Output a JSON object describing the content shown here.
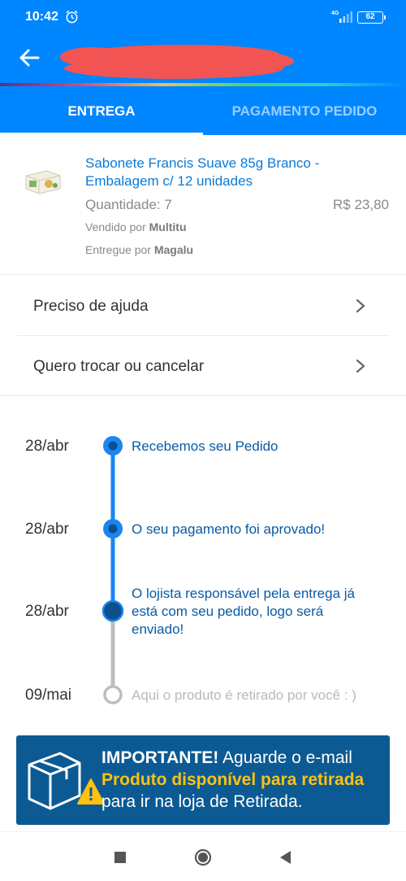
{
  "status_bar": {
    "time": "10:42",
    "network": "4G",
    "battery": "62"
  },
  "header": {
    "back_icon": "arrow-left-icon",
    "title": ""
  },
  "tabs": [
    {
      "label": "ENTREGA",
      "active": true
    },
    {
      "label": "PAGAMENTO PEDIDO",
      "active": false
    }
  ],
  "product": {
    "title": "Sabonete Francis Suave 85g Branco - Embalagem c/ 12 unidades",
    "quantity": "Quantidade: 7",
    "price": "R$ 23,80",
    "seller_prefix": "Vendido por",
    "seller_name": "Multitu",
    "delivery_prefix": "Entregue por",
    "delivery_name": "Magalu"
  },
  "menu": [
    {
      "label": "Preciso de ajuda",
      "icon": "chevron-right-icon"
    },
    {
      "label": "Quero trocar ou cancelar",
      "icon": "chevron-right-icon"
    }
  ],
  "timeline": [
    {
      "date": "28/abr",
      "text": "Recebemos seu Pedido",
      "status": "done"
    },
    {
      "date": "28/abr",
      "text": "O seu pagamento foi aprovado!",
      "status": "done"
    },
    {
      "date": "28/abr",
      "text": "O lojista responsável pela entrega já está com seu pedido, logo será enviado!",
      "status": "current"
    },
    {
      "date": "09/mai",
      "text": "Aqui o produto é retirado por você : )",
      "status": "pending"
    }
  ],
  "banner": {
    "icon": "package-warning-icon",
    "strong": "IMPORTANTE!",
    "text1": " Aguarde o e-mail",
    "highlight": "Produto disponível para retirada",
    "text2": "para ir na loja de Retirada."
  },
  "colors": {
    "primary": "#0086ff",
    "link": "#0a7bd6",
    "banner_bg": "#0b5a93",
    "highlight": "#ffc20e"
  },
  "nav": [
    "recents-square-icon",
    "home-circle-icon",
    "back-triangle-icon"
  ]
}
